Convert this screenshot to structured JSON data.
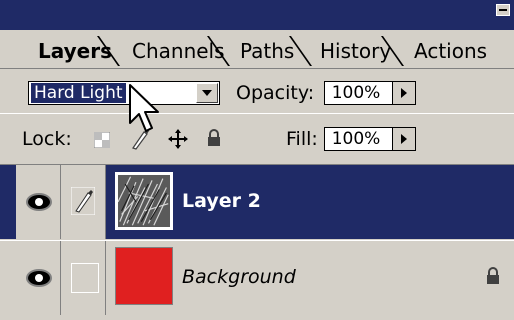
{
  "panel": {
    "tabs": [
      {
        "label": "Layers",
        "active": true
      },
      {
        "label": "Channels",
        "active": false
      },
      {
        "label": "Paths",
        "active": false
      },
      {
        "label": "History",
        "active": false
      },
      {
        "label": "Actions",
        "active": false
      }
    ]
  },
  "controls": {
    "blend_mode": "Hard Light",
    "opacity_label": "Opacity:",
    "opacity_value": "100%",
    "lock_label": "Lock:",
    "fill_label": "Fill:",
    "fill_value": "100%"
  },
  "layers": [
    {
      "name": "Layer 2",
      "selected": true,
      "visible": true,
      "locked": false
    },
    {
      "name": "Background",
      "selected": false,
      "visible": true,
      "locked": true
    }
  ],
  "colors": {
    "selection": "#1f2a66",
    "panel_bg": "#d4d0c8",
    "background_layer_fill": "#e02020"
  },
  "icons": [
    "panel-menu-icon",
    "dropdown-arrow-icon",
    "stepper-arrow-icon",
    "lock-transparent-icon",
    "lock-image-icon",
    "lock-position-icon",
    "lock-all-icon",
    "eye-icon",
    "brush-link-icon",
    "lock-icon",
    "arrow-cursor-icon"
  ]
}
